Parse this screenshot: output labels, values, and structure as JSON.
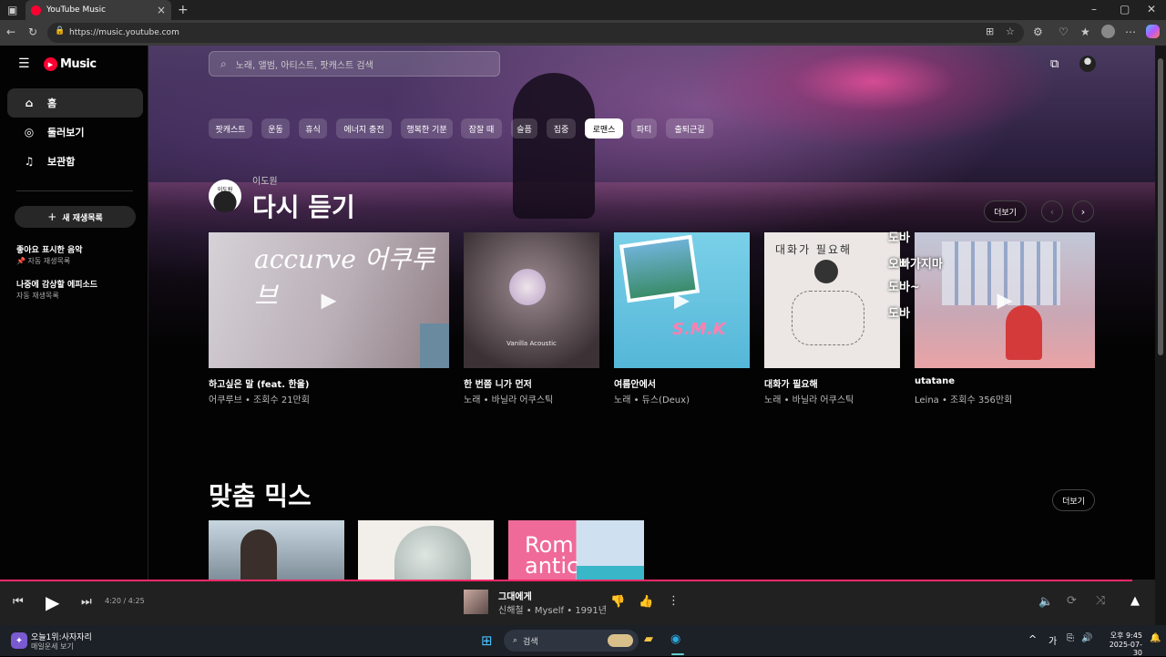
{
  "browser": {
    "tab_title": "YouTube Music",
    "url": "https://music.youtube.com"
  },
  "app": {
    "logo": "Music",
    "search_placeholder": "노래, 앨범, 아티스트, 팟캐스트 검색"
  },
  "sidebar": {
    "items": [
      {
        "label": "홈",
        "icon": "home-icon"
      },
      {
        "label": "둘러보기",
        "icon": "compass-icon"
      },
      {
        "label": "보관함",
        "icon": "library-icon"
      }
    ],
    "new_playlist": "새 재생목록",
    "playlists": [
      {
        "title": "좋아요 표시한 음악",
        "sub": "자동 재생목록"
      },
      {
        "title": "나중에 감상할 에피소드",
        "sub": "자동 재생목록"
      }
    ]
  },
  "chips": [
    "팟캐스트",
    "운동",
    "휴식",
    "에너지 충전",
    "행복한 기분",
    "잠잘 때",
    "슬픔",
    "집중",
    "로맨스",
    "파티",
    "출퇴근길"
  ],
  "active_chip": "로맨스",
  "listen_again": {
    "user": "이도원",
    "avatar_text": "이도원",
    "title": "다시 듣기",
    "more": "더보기",
    "cards": [
      {
        "title": "하고싶은 말 (feat. 한울)",
        "sub": "어쿠루브 • 조회수 21만회",
        "art_text": "accurve 어쿠루브",
        "color": "#c9c0c8"
      },
      {
        "title": "한 번쯤 니가 먼저",
        "sub": "노래 • 바닐라 어쿠스틱",
        "art_text": "Vanilla Acoustic",
        "color": "#6b5a60"
      },
      {
        "title": "여름안에서",
        "sub": "노래 • 듀스(Deux)",
        "art_text": "S.M.K",
        "color": "#6fc6e0"
      },
      {
        "title": "대화가 필요해",
        "sub": "노래 • 바닐라 어쿠스틱",
        "art_text": "대화가 필요해",
        "color": "#ebe6e3"
      },
      {
        "title": "utatane",
        "sub": "Leina • 조회수 356만회",
        "art_text": "",
        "color": "#c8a8b0"
      }
    ],
    "overlay_lyrics": [
      "도바",
      "오빠가지마",
      "도바~",
      "도바"
    ]
  },
  "mix": {
    "title": "맞춤 믹스",
    "more": "더보기",
    "cards": [
      {
        "art_text": "",
        "color": "#8ca6b8"
      },
      {
        "art_text": "",
        "color": "#e7e4df"
      },
      {
        "art_text": "Rom antic",
        "color": "#e85b8c"
      }
    ]
  },
  "player": {
    "time": "4:20 / 4:25",
    "song_title": "그대에게",
    "song_sub": "신해철 • Myself • 1991년",
    "progress": 0.98
  },
  "taskbar": {
    "weather_title": "오늘1위:사자자리",
    "weather_sub": "매일운세 보기",
    "search": "검색",
    "ime": "가",
    "time": "오후 9:45",
    "date": "2025-07-30"
  },
  "colors": {
    "accent": "#ff0033",
    "progress": "#ff2a6a"
  }
}
